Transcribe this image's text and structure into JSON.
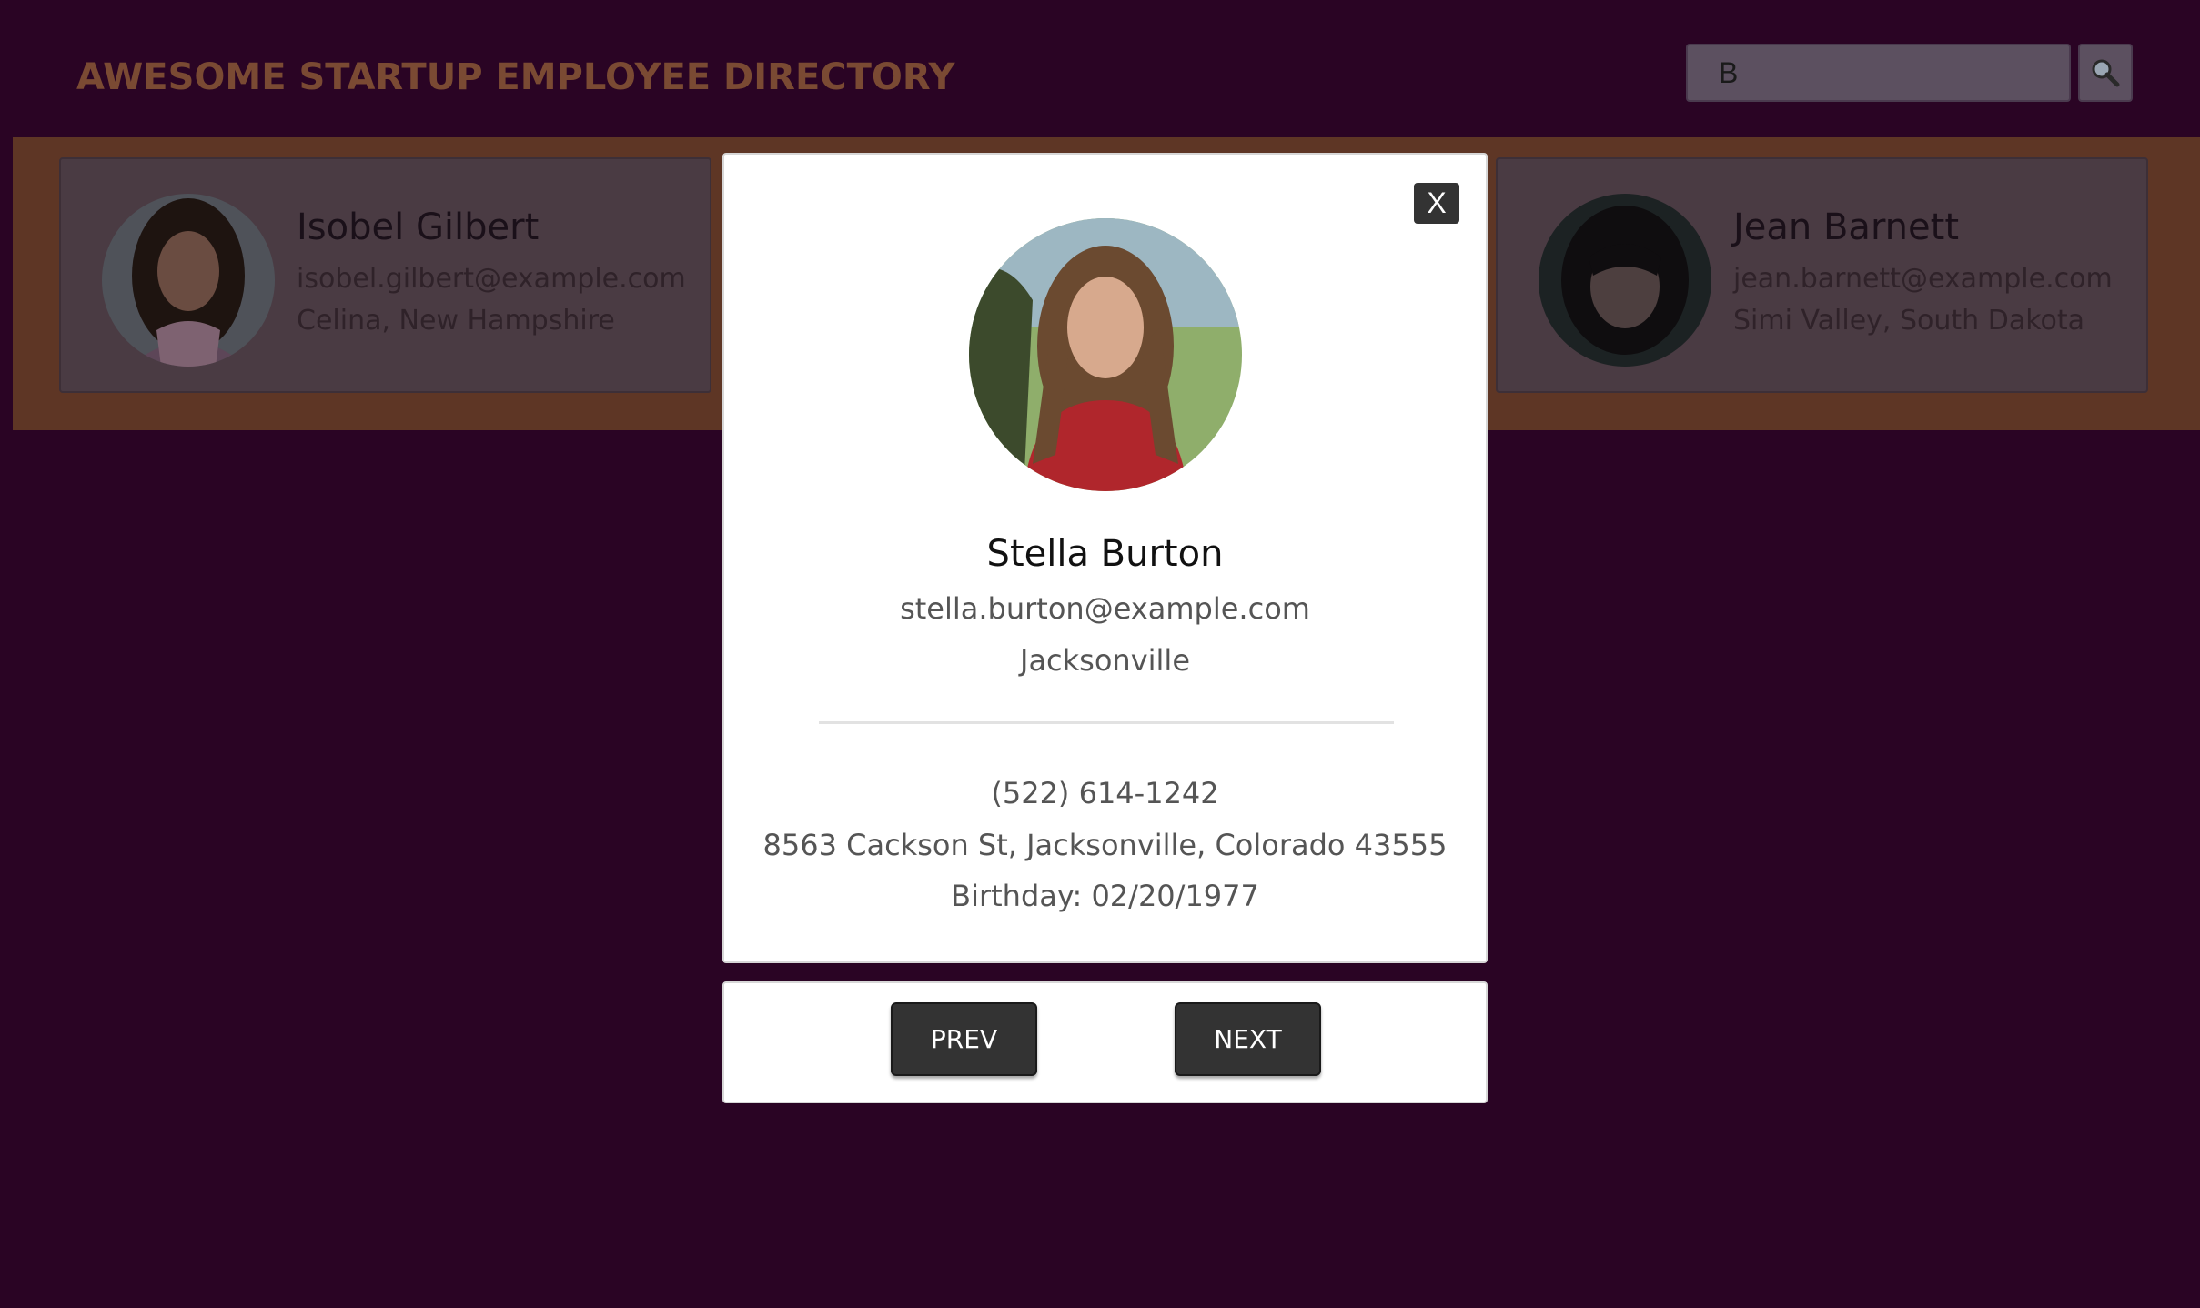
{
  "header": {
    "title": "AWESOME STARTUP EMPLOYEE DIRECTORY",
    "search": {
      "value": "B",
      "icon": "magnifier-icon"
    }
  },
  "gallery": {
    "cards": [
      {
        "name": "Isobel Gilbert",
        "email": "isobel.gilbert@example.com",
        "location": "Celina, New Hampshire"
      },
      {
        "name": "Jean Barnett",
        "email": "jean.barnett@example.com",
        "location": "Simi Valley, South Dakota"
      }
    ]
  },
  "modal": {
    "close_label": "X",
    "name": "Stella Burton",
    "email": "stella.burton@example.com",
    "city": "Jacksonville",
    "phone": "(522) 614-1242",
    "address": "8563 Cackson St, Jacksonville, Colorado 43555",
    "birthday": "Birthday: 02/20/1977"
  },
  "nav": {
    "prev_label": "PREV",
    "next_label": "NEXT"
  },
  "colors": {
    "background": "#2a0424",
    "gallery_overlay": "#5e3625",
    "button_dark": "#333333"
  }
}
